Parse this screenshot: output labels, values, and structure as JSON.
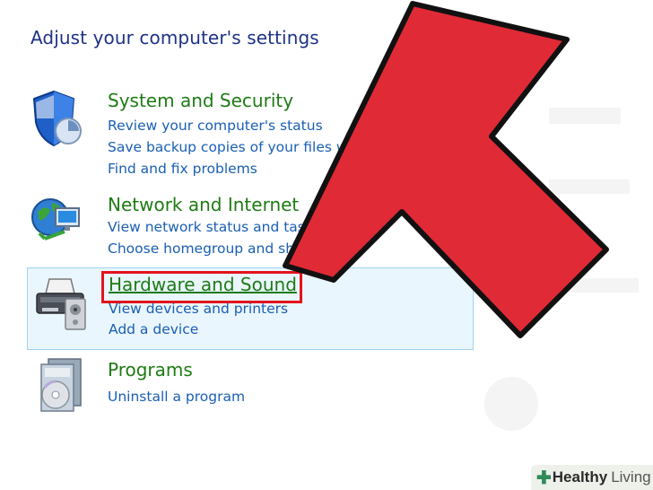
{
  "heading": "Adjust your computer's settings",
  "categories": [
    {
      "title": "System and Security",
      "icon": "shield-icon",
      "links": [
        "Review your computer's status",
        "Save backup copies of your files wi",
        "Find and fix problems"
      ]
    },
    {
      "title": "Network and Internet",
      "icon": "globe-network-icon",
      "links": [
        "View network status and task",
        "Choose homegroup and sha          options"
      ]
    },
    {
      "title": "Hardware and Sound",
      "icon": "printer-icon",
      "links": [
        "View devices and printers",
        "Add a device"
      ]
    },
    {
      "title": "Programs",
      "icon": "programs-disc-icon",
      "links": [
        "Uninstall a program"
      ]
    }
  ],
  "annotation": {
    "arrow_color": "#e02a36",
    "highlight_color": "#e2141e"
  },
  "watermark": {
    "brand_bold": "Healthy",
    "brand_regular": "Living"
  }
}
